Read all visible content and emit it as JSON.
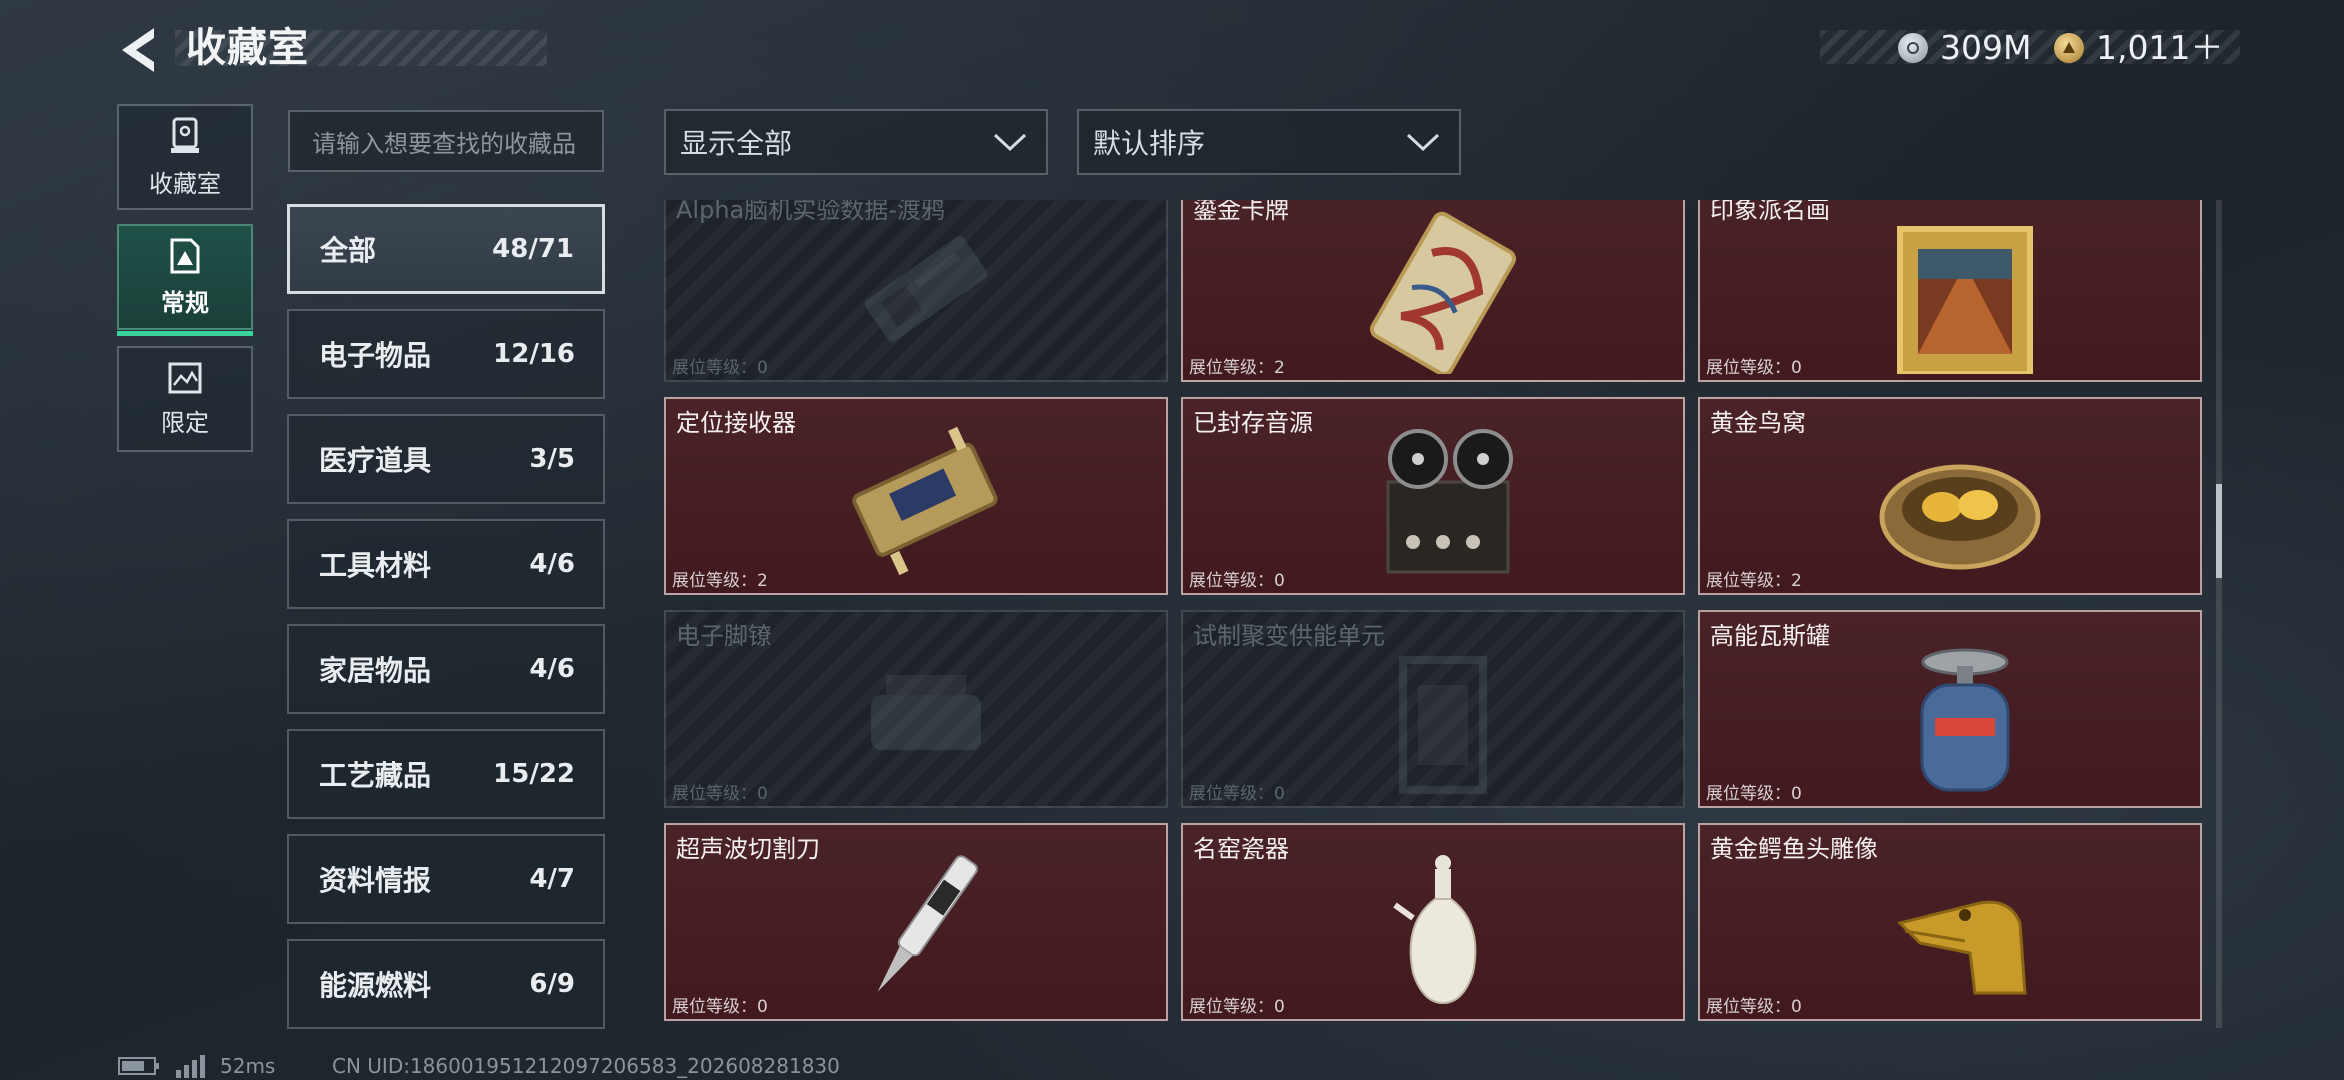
{
  "header": {
    "title": "收藏室",
    "currency_a": "309M",
    "currency_b": "1,011＋"
  },
  "rail": [
    {
      "label": "收藏室",
      "icon": "display-case-icon"
    },
    {
      "label": "常规",
      "icon": "collection-card-icon",
      "active": true
    },
    {
      "label": "限定",
      "icon": "limited-painting-icon"
    }
  ],
  "search": {
    "placeholder": "请输入想要查找的收藏品"
  },
  "filters": {
    "show": "显示全部",
    "sort": "默认排序"
  },
  "categories": [
    {
      "name": "全部",
      "count": "48/71",
      "active": true
    },
    {
      "name": "电子物品",
      "count": "12/16"
    },
    {
      "name": "医疗道具",
      "count": "3/5"
    },
    {
      "name": "工具材料",
      "count": "4/6"
    },
    {
      "name": "家居物品",
      "count": "4/6"
    },
    {
      "name": "工艺藏品",
      "count": "15/22"
    },
    {
      "name": "资料情报",
      "count": "4/7"
    },
    {
      "name": "能源燃料",
      "count": "6/9"
    }
  ],
  "level_label": "展位等级：",
  "items": [
    {
      "name": "Alpha脑机实验数据-渡鸦",
      "level": "0",
      "locked": true,
      "icon": "data-drive-icon"
    },
    {
      "name": "鎏金卡牌",
      "level": "2",
      "locked": false,
      "icon": "gilded-card-icon"
    },
    {
      "name": "印象派名画",
      "level": "0",
      "locked": false,
      "icon": "framed-painting-icon"
    },
    {
      "name": "定位接收器",
      "level": "2",
      "locked": false,
      "icon": "gps-receiver-icon"
    },
    {
      "name": "已封存音源",
      "level": "0",
      "locked": false,
      "icon": "reel-recorder-icon"
    },
    {
      "name": "黄金鸟窝",
      "level": "2",
      "locked": false,
      "icon": "golden-nest-icon"
    },
    {
      "name": "电子脚镣",
      "level": "0",
      "locked": true,
      "icon": "ankle-monitor-icon"
    },
    {
      "name": "试制聚变供能单元",
      "level": "0",
      "locked": true,
      "icon": "fusion-cell-icon"
    },
    {
      "name": "高能瓦斯罐",
      "level": "0",
      "locked": false,
      "icon": "gas-canister-icon"
    },
    {
      "name": "超声波切割刀",
      "level": "0",
      "locked": false,
      "icon": "ultrasonic-knife-icon"
    },
    {
      "name": "名窑瓷器",
      "level": "0",
      "locked": false,
      "icon": "porcelain-vase-icon"
    },
    {
      "name": "黄金鳄鱼头雕像",
      "level": "0",
      "locked": false,
      "icon": "gold-crocodile-icon"
    }
  ],
  "status": {
    "ping": "52ms",
    "uid": "CN UID:18600195121209720658​3_202608281830"
  }
}
